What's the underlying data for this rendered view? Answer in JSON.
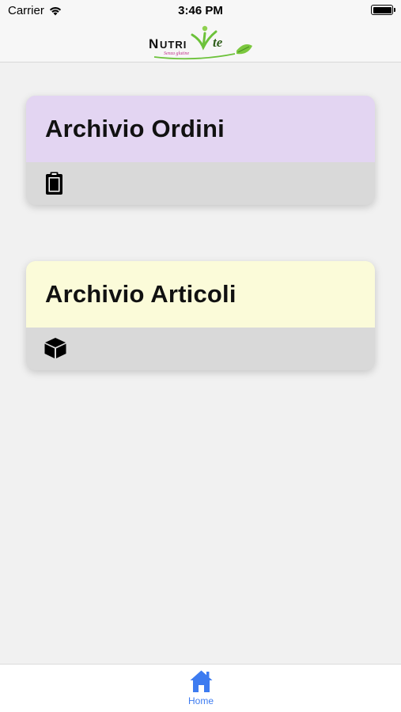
{
  "status_bar": {
    "carrier": "Carrier",
    "time": "3:46 PM"
  },
  "nav": {
    "logo_text": "NUTRIVite",
    "logo_tagline": "Senza glutine"
  },
  "cards": [
    {
      "title": "Archivio Ordini",
      "icon": "clipboard-icon",
      "header_color": "#e3d5f2"
    },
    {
      "title": "Archivio Articoli",
      "icon": "cube-icon",
      "header_color": "#fbfbd9"
    }
  ],
  "tab_bar": {
    "home_label": "Home",
    "accent": "#3d7bf0"
  }
}
